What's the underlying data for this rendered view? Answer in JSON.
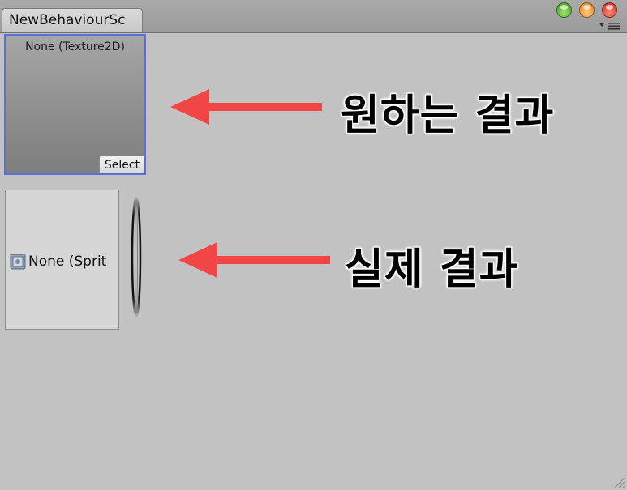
{
  "window": {
    "tab_title": "NewBehaviourSc",
    "controls": [
      "maximize-button",
      "minimize-button",
      "close-button"
    ],
    "colors": {
      "green": "#4caf2a",
      "yellow": "#f09a2c",
      "red": "#d93b2c"
    }
  },
  "texture_field": {
    "label": "None (Texture2D)",
    "select_label": "Select",
    "border_color": "#5b6fd6"
  },
  "sprite_field": {
    "label": "None (Sprit",
    "icon": "sprite-icon"
  },
  "annotations": {
    "desired": "원하는 결과",
    "actual": "실제 결과",
    "arrow_color": "#f24646"
  }
}
